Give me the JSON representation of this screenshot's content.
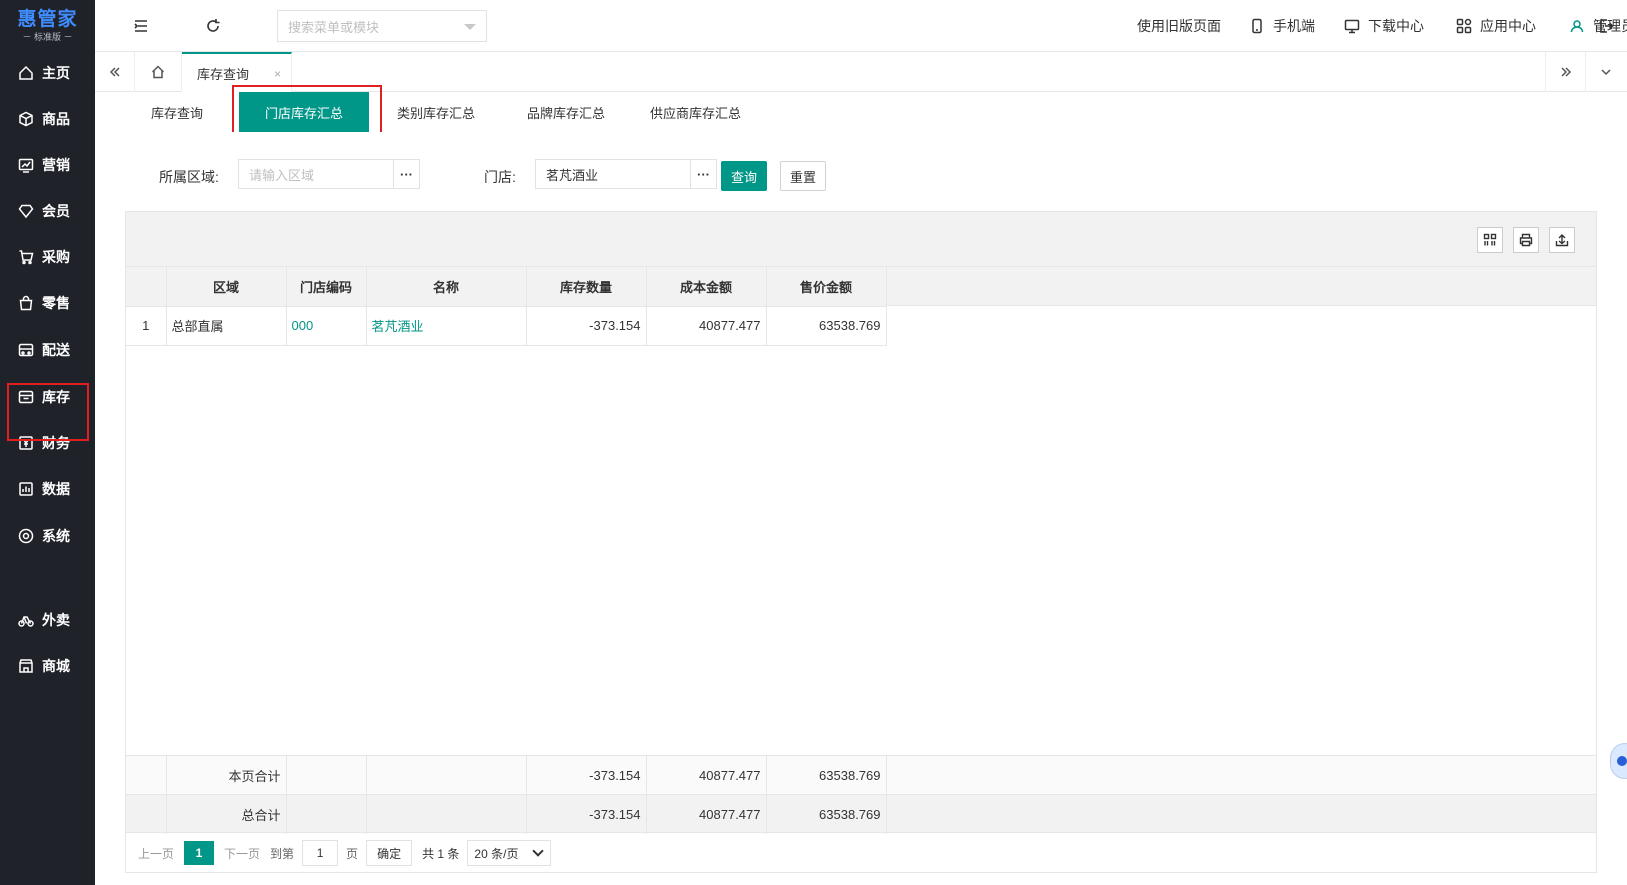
{
  "brand": {
    "name": "惠管家",
    "edition": "－ 标准版 －",
    "accent": "#3f8cff"
  },
  "theme": {
    "primary": "#009688",
    "sidebar_bg": "#20222a",
    "highlight": "#e02020"
  },
  "sidebar": {
    "items": [
      {
        "label": "主页",
        "icon": "home-icon"
      },
      {
        "label": "商品",
        "icon": "box-icon"
      },
      {
        "label": "营销",
        "icon": "chart-icon"
      },
      {
        "label": "会员",
        "icon": "diamond-icon"
      },
      {
        "label": "采购",
        "icon": "cart-icon"
      },
      {
        "label": "零售",
        "icon": "bag-icon"
      },
      {
        "label": "配送",
        "icon": "truck-icon"
      },
      {
        "label": "库存",
        "icon": "inventory-icon",
        "selected": true
      },
      {
        "label": "财务",
        "icon": "yen-icon"
      },
      {
        "label": "数据",
        "icon": "data-icon"
      },
      {
        "label": "系统",
        "icon": "settings-icon"
      },
      {
        "label": "外卖",
        "icon": "bike-icon"
      },
      {
        "label": "商城",
        "icon": "shop-icon"
      }
    ]
  },
  "topbar": {
    "search_placeholder": "搜索菜单或模块",
    "links": {
      "old_page": "使用旧版页面",
      "mobile": "手机端",
      "download": "下载中心",
      "apps": "应用中心",
      "user": "管理员"
    }
  },
  "tabstrip": {
    "active_tab": "库存查询",
    "close": "×"
  },
  "subtabs": [
    "库存查询",
    "门店库存汇总",
    "类别库存汇总",
    "品牌库存汇总",
    "供应商库存汇总"
  ],
  "subtab_active": "门店库存汇总",
  "filters": {
    "area_label": "所属区域:",
    "area_placeholder": "请输入区域",
    "store_label": "门店:",
    "store_value": "茗芃酒业",
    "dots": "···",
    "query_button": "查询",
    "reset_button": "重置"
  },
  "table": {
    "headers": [
      "",
      "区域",
      "门店编码",
      "名称",
      "库存数量",
      "成本金额",
      "售价金额"
    ],
    "rows": [
      {
        "index": "1",
        "area": "总部直属",
        "code": "000",
        "name": "茗芃酒业",
        "qty": "-373.154",
        "cost": "40877.477",
        "sale": "63538.769"
      }
    ],
    "page_total": {
      "label": "本页合计",
      "qty": "-373.154",
      "cost": "40877.477",
      "sale": "63538.769"
    },
    "grand_total": {
      "label": "总合计",
      "qty": "-373.154",
      "cost": "40877.477",
      "sale": "63538.769"
    }
  },
  "pager": {
    "prev": "上一页",
    "current": "1",
    "next": "下一页",
    "goto_label": "到第",
    "goto_value": "1",
    "page_unit": "页",
    "confirm": "确定",
    "total": "共 1 条",
    "page_size": "20 条/页"
  }
}
